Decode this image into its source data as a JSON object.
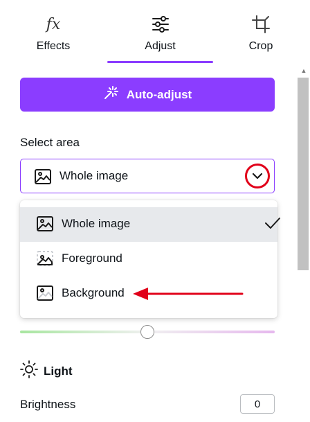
{
  "tabs": [
    {
      "label": "Effects",
      "icon": "fx-icon"
    },
    {
      "label": "Adjust",
      "icon": "sliders-icon",
      "active": true
    },
    {
      "label": "Crop",
      "icon": "crop-icon"
    }
  ],
  "fx_glyph": "fx",
  "auto_adjust": {
    "label": "Auto-adjust",
    "icon": "magic-wand-icon"
  },
  "select_area": {
    "title": "Select area",
    "value": "Whole image",
    "options": [
      {
        "label": "Whole image",
        "selected": true
      },
      {
        "label": "Foreground",
        "selected": false
      },
      {
        "label": "Background",
        "selected": false
      }
    ]
  },
  "light": {
    "heading": "Light",
    "icon": "sun-icon",
    "brightness_label": "Brightness",
    "brightness_value": "0"
  },
  "colors": {
    "accent": "#8b3dff",
    "annotation": "#e1001a",
    "selected_bg": "#e7e9ec"
  }
}
